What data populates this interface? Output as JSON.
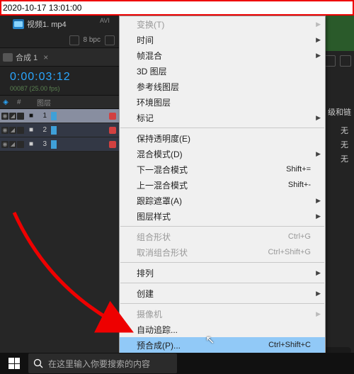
{
  "timestamp": "2020-10-17 13:01:00",
  "project": {
    "file_name": "视频1. mp4",
    "bpc": "8 bpc"
  },
  "composition": {
    "name": "合成 1",
    "close": "×",
    "timecode": "0:00:03:12",
    "subinfo": "00087 (25.00 fps)"
  },
  "layer_header": {
    "selector": "◈",
    "hash": "#",
    "label": "图层"
  },
  "layers": [
    {
      "num": "1",
      "color": "#d24040",
      "selected": true
    },
    {
      "num": "2",
      "color": "#d24040",
      "selected": false
    },
    {
      "num": "3",
      "color": "#d24040",
      "selected": false
    }
  ],
  "right": {
    "avi": "AVI",
    "label_bottom": "级和链",
    "wu": "无"
  },
  "menu": [
    {
      "label": "变换(T)",
      "sub": true,
      "disabled": true
    },
    {
      "label": "时间",
      "sub": true
    },
    {
      "label": "帧混合",
      "sub": true
    },
    {
      "label": "3D 图层"
    },
    {
      "label": "参考线图层"
    },
    {
      "label": "环境图层"
    },
    {
      "label": "标记",
      "sub": true
    },
    {
      "sep": true
    },
    {
      "label": "保持透明度(E)"
    },
    {
      "label": "混合模式(D)",
      "sub": true
    },
    {
      "label": "下一混合模式",
      "shortcut": "Shift+="
    },
    {
      "label": "上一混合模式",
      "shortcut": "Shift+-"
    },
    {
      "label": "跟踪遮罩(A)",
      "sub": true
    },
    {
      "label": "图层样式",
      "sub": true
    },
    {
      "sep": true
    },
    {
      "label": "组合形状",
      "shortcut": "Ctrl+G",
      "disabled": true
    },
    {
      "label": "取消组合形状",
      "shortcut": "Ctrl+Shift+G",
      "disabled": true
    },
    {
      "sep": true
    },
    {
      "label": "排列",
      "sub": true
    },
    {
      "sep": true
    },
    {
      "label": "创建",
      "sub": true
    },
    {
      "sep": true
    },
    {
      "label": "摄像机",
      "sub": true,
      "disabled": true
    },
    {
      "label": "自动追踪..."
    },
    {
      "label": "预合成(P)...",
      "shortcut": "Ctrl+Shift+C",
      "hi": true
    }
  ],
  "taskbar": {
    "search_placeholder": "在这里输入你要搜索的内容"
  }
}
